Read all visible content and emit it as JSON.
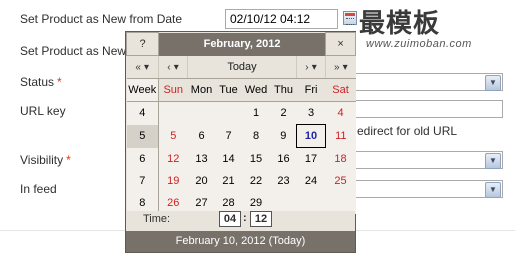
{
  "form": {
    "rows": [
      {
        "label": "Set Product as New from Date",
        "required": false
      },
      {
        "label": "Set Product as New",
        "required": false
      },
      {
        "label": "Status",
        "required": true
      },
      {
        "label": "URL key",
        "required": false
      },
      {
        "label": "Visibility",
        "required": true
      },
      {
        "label": "In feed",
        "required": false
      }
    ],
    "required_marker": "*",
    "date_value": "02/10/12 04:12",
    "redirect_text": "edirect for old URL",
    "select_arrow": "▼"
  },
  "watermark": {
    "main": "最模板",
    "url": "www.zuimoban.com"
  },
  "calendar": {
    "help_button": "?",
    "close_button": "×",
    "title": "February, 2012",
    "nav": {
      "prev_year": "«",
      "prev_month": "‹",
      "today": "Today",
      "next_month": "›",
      "next_year": "»",
      "dropdown_marker": "▾"
    },
    "headers": [
      "Week",
      "Sun",
      "Mon",
      "Tue",
      "Wed",
      "Thu",
      "Fri",
      "Sat"
    ],
    "weeks": [
      {
        "week": "4",
        "days": [
          "",
          "",
          "",
          "1",
          "2",
          "3",
          "4"
        ]
      },
      {
        "week": "5",
        "days": [
          "5",
          "6",
          "7",
          "8",
          "9",
          "10",
          "11"
        ]
      },
      {
        "week": "6",
        "days": [
          "12",
          "13",
          "14",
          "15",
          "16",
          "17",
          "18"
        ]
      },
      {
        "week": "7",
        "days": [
          "19",
          "20",
          "21",
          "22",
          "23",
          "24",
          "25"
        ]
      },
      {
        "week": "8",
        "days": [
          "26",
          "27",
          "28",
          "29",
          "",
          "",
          ""
        ]
      }
    ],
    "selected_day": "10",
    "active_week": "5",
    "time_label": "Time:",
    "hour": "04",
    "time_separator": ":",
    "minute": "12",
    "status": "February 10, 2012 (Today)",
    "colors": {
      "title_bg": "#77716a",
      "weekend": "#cc2222",
      "selected_text": "#2323a8"
    }
  }
}
